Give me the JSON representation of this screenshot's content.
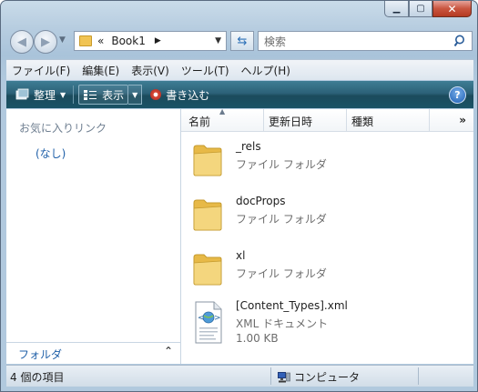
{
  "address": {
    "chevron": "«",
    "crumb": "Book1"
  },
  "search": {
    "placeholder": "検索"
  },
  "menu": [
    "ファイル(F)",
    "編集(E)",
    "表示(V)",
    "ツール(T)",
    "ヘルプ(H)"
  ],
  "toolbar": {
    "organize": "整理",
    "views": "表示",
    "burn": "書き込む"
  },
  "nav_pane": {
    "favorites_title": "お気に入りリンク",
    "favorites_empty": "(なし)",
    "folders_label": "フォルダ"
  },
  "columns": {
    "name": "名前",
    "date": "更新日時",
    "type": "種類",
    "more": "»"
  },
  "items": [
    {
      "name": "_rels",
      "type": "ファイル フォルダ",
      "kind": "folder"
    },
    {
      "name": "docProps",
      "type": "ファイル フォルダ",
      "kind": "folder"
    },
    {
      "name": "xl",
      "type": "ファイル フォルダ",
      "kind": "folder"
    },
    {
      "name": "[Content_Types].xml",
      "type": "XML ドキュメント",
      "size": "1.00 KB",
      "kind": "xml"
    }
  ],
  "status": {
    "count": "4 個の項目",
    "zone": "コンピュータ"
  },
  "colors": {
    "toolbar": "#2c6178",
    "link": "#1e5fa8",
    "close": "#c9553f"
  }
}
